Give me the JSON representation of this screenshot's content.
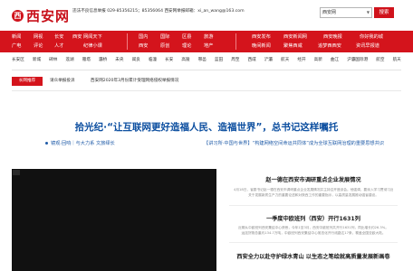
{
  "header": {
    "logo_mark": "西",
    "logo_text": "西安网",
    "report_line1": "违法不良信息举报 029-85356215；85356064 西安网举报邮箱：xi_an_wang@163.com",
    "report_line2": "",
    "search_scope": "西安网",
    "search_button": "搜索"
  },
  "nav": {
    "groups": [
      {
        "top": [
          "新闻",
          "网视",
          "长安",
          "西安",
          "网闻天下"
        ],
        "bottom": [
          "广电",
          "评论",
          "人才",
          "纪律小课"
        ]
      },
      {
        "top": [
          "国内",
          "国际",
          "区县",
          "旅游"
        ],
        "bottom": [
          "西安",
          "原创",
          "理论",
          "地产"
        ]
      },
      {
        "top": [
          "西安发布",
          "西安新闻网",
          "西安晚报",
          "你好我的城"
        ],
        "bottom": [
          "晚间新闻",
          "聚焦西咸",
          "追梦西西安",
          "资讯早报道"
        ]
      }
    ]
  },
  "cities": [
    "长安区",
    "新城",
    "碑林",
    "莲湖",
    "雁塔",
    "灞桥",
    "未央",
    "阎良",
    "临潼",
    "长安",
    "高陵",
    "鄠邑",
    "蓝田",
    "周至",
    "西咸",
    "浐灞",
    "航天",
    "经开",
    "高新",
    "曲江",
    "沪灞国际港",
    "航空",
    "航天"
  ],
  "notice": {
    "tag": "长网推荐",
    "items": [
      "请众举报投诉",
      "西安网2020年3月份累计受理网络侵权举报情况"
    ]
  },
  "headline": {
    "title": "拾光纪·“让互联网更好造福人民、造福世界”，总书记这样嘱托",
    "sub_left": "镜观·回响｜与大力系 文旅绎长",
    "sub_right": "【讲习所·中国与世界】“构建网络空间命运共同体”成为全球互联网治理的重要思想共识"
  },
  "news": [
    {
      "title": "赵一德在西安市调研重点企业发展情况",
      "desc": [
        "4月18日，省委书记赵一德在西安市调研重点企业发展情况并主持召开座谈会。他强调，要深入学习贯彻习近平总书记",
        "关于发展新质生产力的重要论述和对陕西工作的重要指示，以高质量发展推动强省建设。"
      ]
    },
    {
      "title": "一季度中欧班列（西安）开行1631列",
      "desc": [
        "近期从中欧班列西安集结中心获悉，今年1至3月，西安中欧班列共开行1631列，同比增长约26.3%。",
        "运送货物总重约134.7万吨，中欧班列西安集结中心常态化开行线路达17条，覆盖全国亚欧大陆。"
      ]
    },
    {
      "title": "西安全力以赴守护绿水青山 以生态之笔绘就高质量发展新画卷",
      "desc": []
    }
  ]
}
